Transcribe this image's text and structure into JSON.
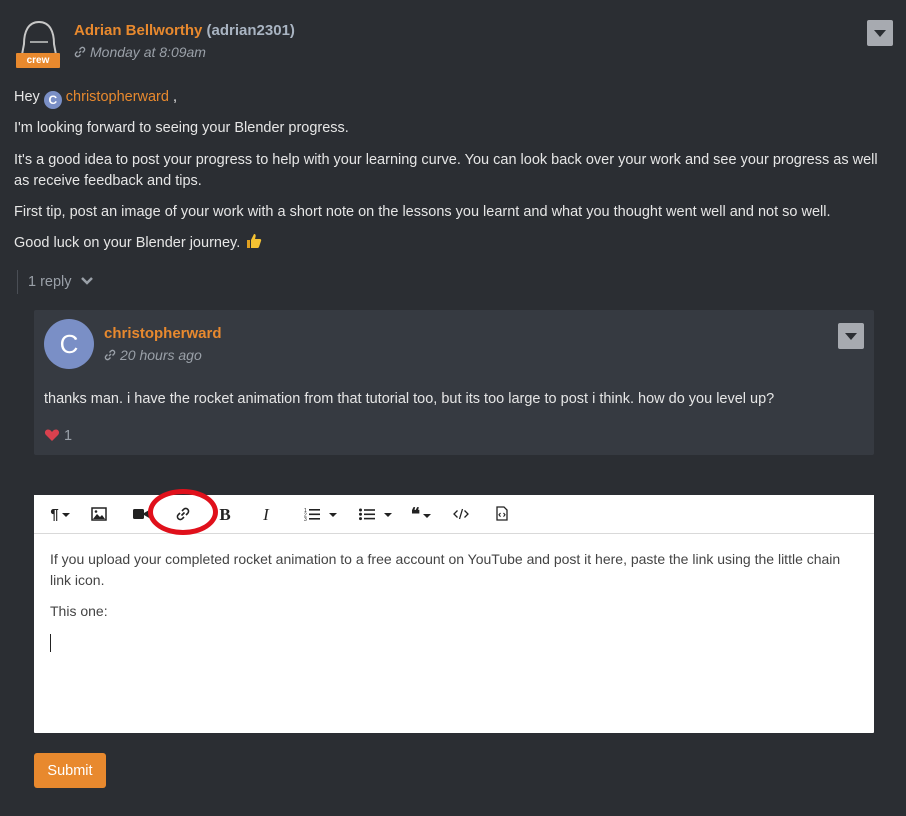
{
  "post": {
    "author_name": "Adrian Bellworthy",
    "author_handle": "(adrian2301)",
    "badge": "crew",
    "timestamp": "Monday at 8:09am",
    "greeting": "Hey",
    "mention_initial": "C",
    "mention_name": "christopherward",
    "mention_suffix": ",",
    "paragraphs": [
      "I'm looking forward to seeing your Blender progress.",
      "It's a good idea to post your progress to help with your learning curve. You can look back over your work and see your progress as well as receive feedback and tips.",
      "First tip, post an image of your work with a short note on the lessons you learnt and what you thought went well and not so well.",
      "Good luck on your Blender journey."
    ],
    "replies_label": "1 reply"
  },
  "reply": {
    "avatar_initial": "C",
    "author_name": "christopherward",
    "timestamp": "20 hours ago",
    "text": "thanks man.   i have the rocket animation from that tutorial too, but its too large to post i think.   how do you level up?",
    "likes": "1"
  },
  "editor": {
    "toolbar": [
      "paragraph-format",
      "image",
      "video",
      "link",
      "bold",
      "italic",
      "ordered-list",
      "bullet-list",
      "quote",
      "code",
      "source"
    ],
    "paragraphs": [
      "If you upload your completed rocket animation to a free account on YouTube and post it here, paste the link using the little chain link icon.",
      "This one:"
    ]
  },
  "submit_label": "Submit",
  "colors": {
    "background": "#2b2e33",
    "accent": "#e8892e",
    "card": "#363a41",
    "highlight": "#e0101b"
  }
}
